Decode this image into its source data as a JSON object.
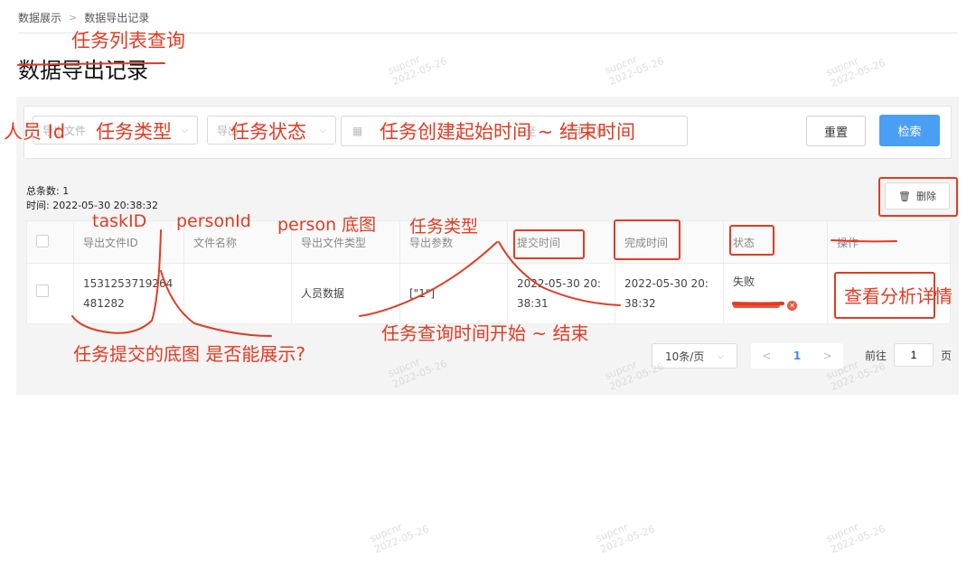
{
  "breadcrumb": {
    "root": "数据展示",
    "separator": ">",
    "current": "数据导出记录"
  },
  "page_title": "数据导出记录",
  "filters": {
    "export_file_id_placeholder": "导出文件",
    "export_type_placeholder": "导出",
    "date_start_placeholder": "",
    "date_sep": "至",
    "date_end_placeholder": "结束日期",
    "reset_label": "重置",
    "search_label": "检索"
  },
  "summary": {
    "total": "总条数: 1",
    "time": "时间: 2022-05-30 20:38:32"
  },
  "delete_label": "删除",
  "table": {
    "headers": [
      "导出文件ID",
      "文件名称",
      "导出文件类型",
      "导出参数",
      "提交时间",
      "完成时间",
      "状态",
      "操作"
    ],
    "rows": [
      {
        "id": "1531253719264481282",
        "file_name": "",
        "type": "人员数据",
        "params": "[\"1\"]",
        "submit_time": "2022-05-30 20:38:31",
        "finish_time": "2022-05-30 20:38:32",
        "status": "失败",
        "action": ""
      }
    ]
  },
  "pagination": {
    "page_size": "10条/页",
    "current_page": "1",
    "goto_label": "前往",
    "goto_value": "1",
    "page_suffix": "页"
  },
  "watermark": {
    "line1": "supcnr",
    "line2": "2022-05-26"
  },
  "annotations": {
    "task_list_query": "任务列表查询",
    "person_id": "人员 Id",
    "task_type_1": "任务类型",
    "task_status": "任务状态",
    "task_time_range": "任务创建起始时间 ~ 结束时间",
    "task_id": "taskID",
    "person_id_2": "personId",
    "person_base_image": "person 底图",
    "task_type_2": "任务类型",
    "task_query_time": "任务查询时间开始 ~ 结束",
    "base_image_question": "任务提交的底图 是否能展示?",
    "view_analysis": "查看分析详情"
  }
}
